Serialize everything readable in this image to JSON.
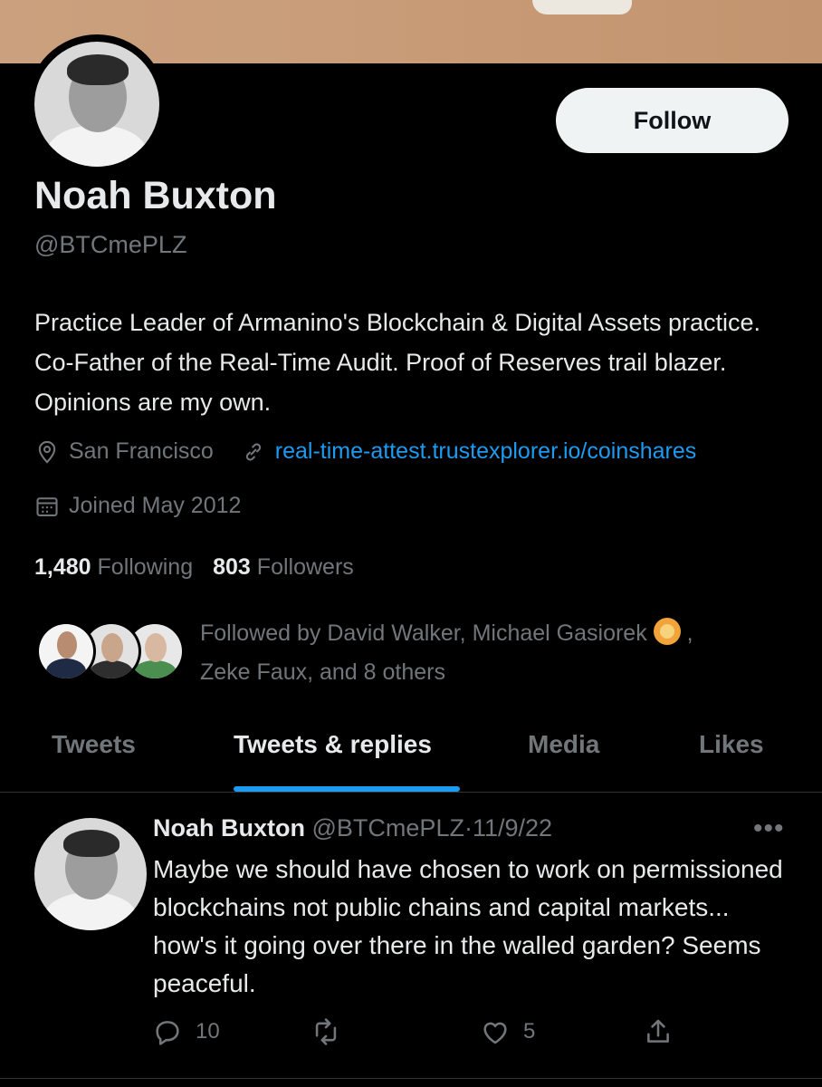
{
  "profile": {
    "name": "Noah Buxton",
    "handle": "@BTCmePLZ",
    "follow_label": "Follow",
    "bio": "Practice Leader of Armanino's Blockchain & Digital Assets practice. Co-Father of the Real-Time Audit. Proof of Reserves trail blazer. Opinions are my own.",
    "location": "San Francisco",
    "website": "real-time-attest.trustexplorer.io/coinshares",
    "joined": "Joined May 2012",
    "following_count": "1,480",
    "following_label": "Following",
    "followers_count": "803",
    "followers_label": "Followers",
    "followed_by_line1": "Followed by David Walker, Michael Gasiorek",
    "followed_by_line2": "Zeke Faux, and 8 others"
  },
  "tabs": [
    {
      "label": "Tweets"
    },
    {
      "label": "Tweets & replies"
    },
    {
      "label": "Media"
    },
    {
      "label": "Likes"
    }
  ],
  "tweet": {
    "author": "Noah Buxton",
    "handle": "@BTCmePLZ",
    "dot": "·",
    "date": "11/9/22",
    "more": "•••",
    "text": "Maybe we should have chosen to work on permissioned blockchains not public chains and capital markets... how's it going over there in the walled garden? Seems peaceful.",
    "reply_count": "10",
    "like_count": "5"
  },
  "colors": {
    "accent": "#1d9bf0",
    "background": "#000000",
    "muted": "#71767b"
  }
}
